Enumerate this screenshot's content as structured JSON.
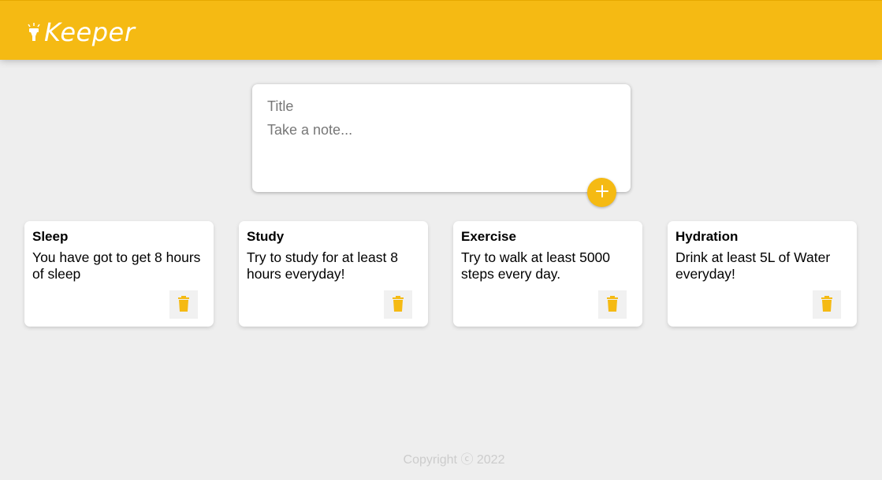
{
  "header": {
    "title": "Keeper",
    "icon": "flashlight-icon",
    "color": "#f5ba13"
  },
  "create_note": {
    "title_placeholder": "Title",
    "content_placeholder": "Take a note...",
    "add_icon": "plus-icon"
  },
  "notes": [
    {
      "title": "Sleep",
      "content": "You have got to get 8 hours\nof sleep",
      "delete_icon": "trash-icon"
    },
    {
      "title": "Study",
      "content": "Try to study for at least 8\nhours everyday!",
      "delete_icon": "trash-icon"
    },
    {
      "title": "Exercise",
      "content": "Try to walk at least 5000\nsteps every day.",
      "delete_icon": "trash-icon"
    },
    {
      "title": "Hydration",
      "content": "Drink at least 5L of Water\neveryday!",
      "delete_icon": "trash-icon"
    }
  ],
  "footer": {
    "text": "Copyright ⓒ 2022"
  },
  "colors": {
    "accent": "#f5ba13",
    "background": "#eeeeee"
  }
}
